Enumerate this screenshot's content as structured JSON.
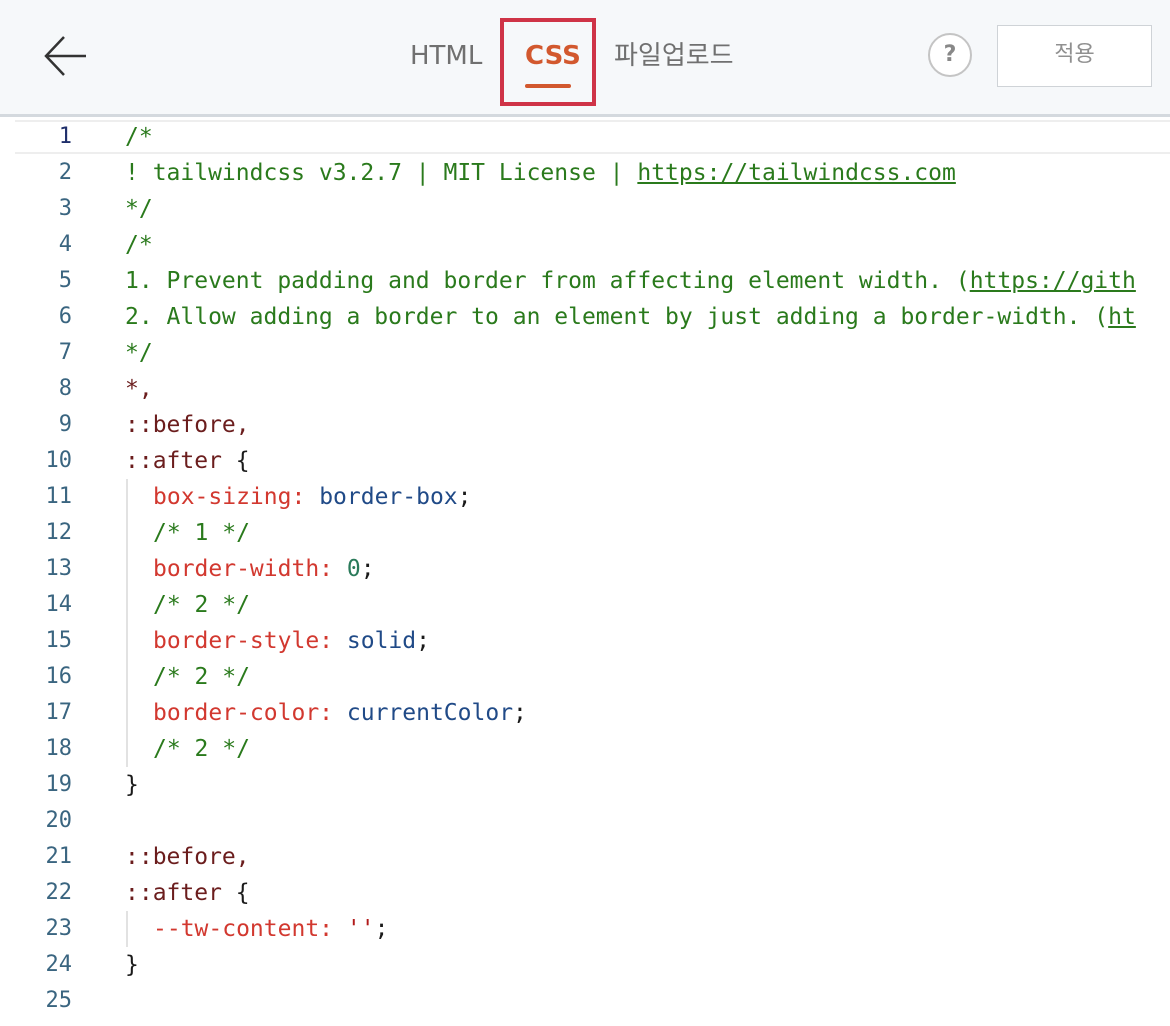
{
  "header": {
    "back_icon": "arrow-left-icon",
    "tabs": [
      {
        "label": "HTML",
        "active": false
      },
      {
        "label": "CSS",
        "active": true
      },
      {
        "label": "파일업로드",
        "active": false
      }
    ],
    "help_label": "?",
    "apply_label": "적용",
    "accent_color": "#d2582e",
    "highlight_color": "#cf3347"
  },
  "editor": {
    "line_numbers": [
      "1",
      "2",
      "3",
      "4",
      "5",
      "6",
      "7",
      "8",
      "9",
      "10",
      "11",
      "12",
      "13",
      "14",
      "15",
      "16",
      "17",
      "18",
      "19",
      "20",
      "21",
      "22",
      "23",
      "24",
      "25"
    ],
    "code": {
      "l1": "/*",
      "l2_pre": "! tailwindcss v3.2.7 | MIT License | ",
      "l2_link": "https://tailwindcss.com",
      "l3": "*/",
      "l4": "/*",
      "l5_pre": "1. Prevent padding and border from affecting element width. (",
      "l5_link": "https://gith",
      "l6_pre": "2. Allow adding a border to an element by just adding a border-width. (",
      "l6_link": "ht",
      "l7": "*/",
      "l8": "*,",
      "l9": "::before,",
      "l10_sel": "::after",
      "l10_brace": " {",
      "l11_prop": "box-sizing",
      "l11_colon": ": ",
      "l11_val": "border-box",
      "l11_end": ";",
      "l12": "/* 1 */",
      "l13_prop": "border-width",
      "l13_colon": ": ",
      "l13_val": "0",
      "l13_end": ";",
      "l14": "/* 2 */",
      "l15_prop": "border-style",
      "l15_colon": ": ",
      "l15_val": "solid",
      "l15_end": ";",
      "l16": "/* 2 */",
      "l17_prop": "border-color",
      "l17_colon": ": ",
      "l17_val": "currentColor",
      "l17_end": ";",
      "l18": "/* 2 */",
      "l19": "}",
      "l20": "",
      "l21": "::before,",
      "l22_sel": "::after",
      "l22_brace": " {",
      "l23_prop": "--tw-content",
      "l23_colon": ": ",
      "l23_val": "''",
      "l23_end": ";",
      "l24": "}",
      "l25": ""
    }
  }
}
